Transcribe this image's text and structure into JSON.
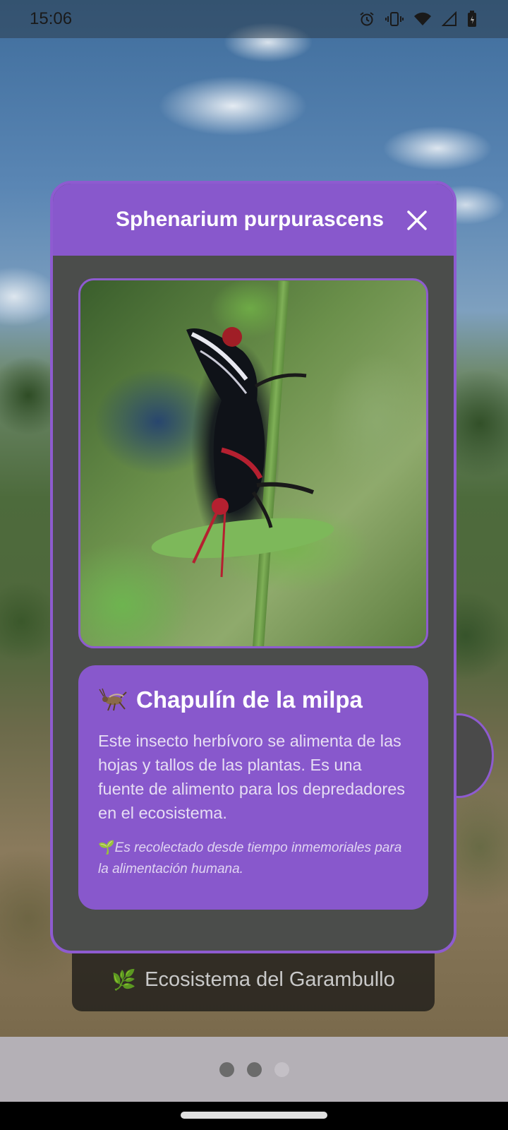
{
  "status_bar": {
    "time": "15:06",
    "icons": [
      "alarm-icon",
      "vibrate-icon",
      "wifi-icon",
      "signal-icon",
      "battery-icon"
    ]
  },
  "dialog": {
    "title": "Sphenarium purpurascens",
    "close_icon": "close-icon",
    "image_alt": "Sphenarium purpurascens grasshopper on plant stem",
    "card": {
      "icon": "cricket-icon",
      "title": "Chapulín de la milpa",
      "description": "Este insecto herbívoro se alimenta de las hojas y tallos de las plantas. Es una fuente de alimento para los depredadores en el ecosistema.",
      "note": "Es recolectado desde tiempo inmemoriales para la alimentación humana.",
      "note_icon": "sprout-icon"
    }
  },
  "background_label": {
    "icon": "herb-icon",
    "text": "Ecosistema del Garambullo"
  },
  "pager": {
    "count": 3,
    "active_index": 2
  },
  "colors": {
    "accent": "#8858cc",
    "dialog_bg": "#4b4d4b",
    "border": "#8e5bd0"
  }
}
